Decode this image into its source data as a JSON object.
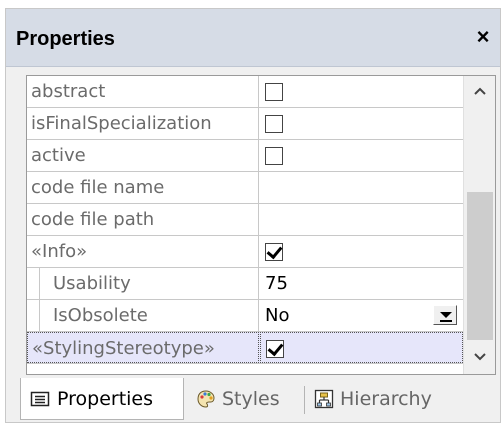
{
  "panel": {
    "title": "Properties",
    "close_glyph": "×"
  },
  "properties": [
    {
      "name": "abstract",
      "type": "checkbox",
      "checked": false
    },
    {
      "name": "isFinalSpecialization",
      "type": "checkbox",
      "checked": false
    },
    {
      "name": "active",
      "type": "checkbox",
      "checked": false
    },
    {
      "name": "code file name",
      "type": "text",
      "value": ""
    },
    {
      "name": "code file path",
      "type": "text",
      "value": ""
    },
    {
      "name": "«Info»",
      "type": "checkbox",
      "checked": true
    },
    {
      "name": "Usability",
      "type": "text",
      "value": "75",
      "child": true
    },
    {
      "name": "IsObsolete",
      "type": "dropdown",
      "value": "No",
      "child": true
    },
    {
      "name": "«StylingStereotype»",
      "type": "checkbox",
      "checked": true,
      "selected": true
    }
  ],
  "tabs": [
    {
      "label": "Properties",
      "icon": "properties-list-icon",
      "active": true
    },
    {
      "label": "Styles",
      "icon": "styles-palette-icon",
      "active": false
    },
    {
      "label": "Hierarchy",
      "icon": "hierarchy-icon",
      "active": false
    }
  ],
  "colors": {
    "titlebar": "#d6dce6",
    "selected_row": "#e6e6fa",
    "label_text": "#6b6b6b"
  }
}
